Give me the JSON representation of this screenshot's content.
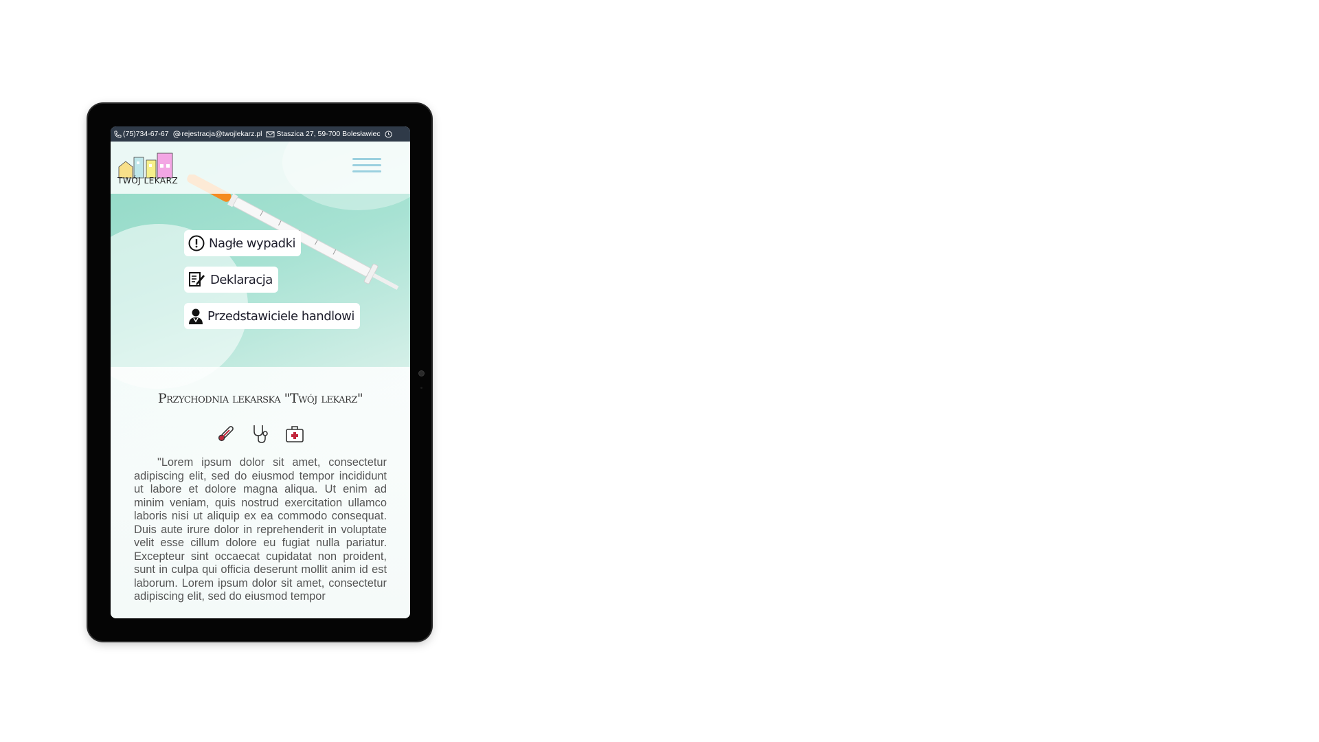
{
  "contact": {
    "phone": "(75)734-67-67",
    "email": "rejestracja@twojlekarz.pl",
    "address": "Staszica 27, 59-700 Bolesławiec"
  },
  "logo": {
    "text": "TWÓJ LEKARZ"
  },
  "quick_links": [
    {
      "label": "Nagłe wypadki",
      "icon": "exclamation-circle-icon"
    },
    {
      "label": "Deklaracja",
      "icon": "document-edit-icon"
    },
    {
      "label": "Przedstawiciele handlowi",
      "icon": "doctor-icon"
    }
  ],
  "section": {
    "title": "Przychodnia lekarska \"Twój lekarz\"",
    "icons": [
      "thermometer-icon",
      "stethoscope-icon",
      "first-aid-kit-icon"
    ],
    "body": "\"Lorem ipsum dolor sit amet, consectetur adipiscing elit, sed do eiusmod tempor incididunt ut labore et dolore magna aliqua. Ut enim ad minim veniam, quis nostrud exercitation ullamco laboris nisi ut aliquip ex ea commodo consequat. Duis aute irure dolor in reprehenderit in voluptate velit esse cillum dolore eu fugiat nulla pariatur. Excepteur sint occaecat cupidatat non proident, sunt in culpa qui officia deserunt mollit anim id est laborum. Lorem ipsum dolor sit amet, consectetur adipiscing elit, sed do eiusmod tempor"
  },
  "colors": {
    "contact_bar": "#2f3a48",
    "hamburger": "#9bd0df",
    "hero_mint": "#a7e2d3",
    "syringe_cap": "#f58a1f"
  }
}
